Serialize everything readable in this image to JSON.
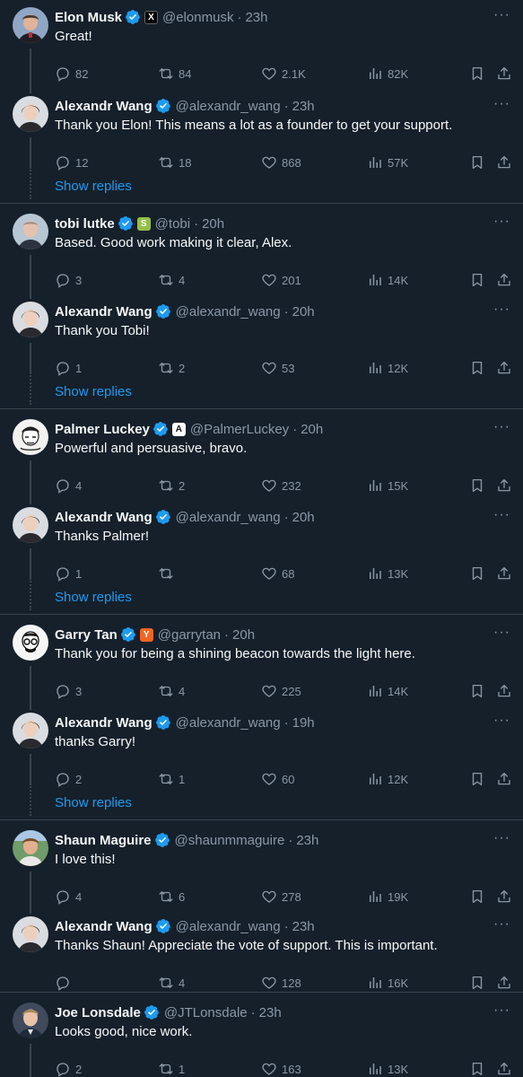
{
  "colors": {
    "background": "#15202b",
    "text": "#f7f9f9",
    "muted": "#8b98a5",
    "accent": "#1d9bf0",
    "divider": "#38444d"
  },
  "show_replies_label": "Show replies",
  "tweets": [
    {
      "name": "Elon Musk",
      "handle": "@elonmusk",
      "time": "23h",
      "affiliation": "X",
      "text": "Great!",
      "replies": "82",
      "retweets": "84",
      "likes": "2.1K",
      "views": "82K"
    },
    {
      "name": "Alexandr Wang",
      "handle": "@alexandr_wang",
      "time": "23h",
      "affiliation": "",
      "text": "Thank you Elon! This means a lot as a founder to get your support.",
      "replies": "12",
      "retweets": "18",
      "likes": "868",
      "views": "57K"
    },
    {
      "name": "tobi lutke",
      "handle": "@tobi",
      "time": "20h",
      "affiliation": "shopify",
      "text": "Based. Good work making it clear, Alex.",
      "replies": "3",
      "retweets": "4",
      "likes": "201",
      "views": "14K"
    },
    {
      "name": "Alexandr Wang",
      "handle": "@alexandr_wang",
      "time": "20h",
      "affiliation": "",
      "text": "Thank you Tobi!",
      "replies": "1",
      "retweets": "2",
      "likes": "53",
      "views": "12K"
    },
    {
      "name": "Palmer Luckey",
      "handle": "@PalmerLuckey",
      "time": "20h",
      "affiliation": "anduril",
      "text": "Powerful and persuasive, bravo.",
      "replies": "4",
      "retweets": "2",
      "likes": "232",
      "views": "15K"
    },
    {
      "name": "Alexandr Wang",
      "handle": "@alexandr_wang",
      "time": "20h",
      "affiliation": "",
      "text": "Thanks Palmer!",
      "replies": "1",
      "retweets": "",
      "likes": "68",
      "views": "13K"
    },
    {
      "name": "Garry Tan",
      "handle": "@garrytan",
      "time": "20h",
      "affiliation": "Y",
      "text": "Thank you for being a shining beacon towards the light here.",
      "replies": "3",
      "retweets": "4",
      "likes": "225",
      "views": "14K"
    },
    {
      "name": "Alexandr Wang",
      "handle": "@alexandr_wang",
      "time": "19h",
      "affiliation": "",
      "text": "thanks Garry!",
      "replies": "2",
      "retweets": "1",
      "likes": "60",
      "views": "12K"
    },
    {
      "name": "Shaun Maguire",
      "handle": "@shaunmmaguire",
      "time": "23h",
      "affiliation": "",
      "text": "I love this!",
      "replies": "4",
      "retweets": "6",
      "likes": "278",
      "views": "19K"
    },
    {
      "name": "Alexandr Wang",
      "handle": "@alexandr_wang",
      "time": "23h",
      "affiliation": "",
      "text": "Thanks Shaun! Appreciate the vote of support. This is important.",
      "replies": "",
      "retweets": "4",
      "likes": "128",
      "views": "16K"
    },
    {
      "name": "Joe Lonsdale",
      "handle": "@JTLonsdale",
      "time": "23h",
      "affiliation": "",
      "text": "Looks good, nice work.",
      "replies": "2",
      "retweets": "1",
      "likes": "163",
      "views": "13K"
    }
  ],
  "icons": [
    "reply-icon",
    "retweet-icon",
    "like-icon",
    "views-icon",
    "bookmark-icon",
    "share-icon",
    "verified-badge-icon",
    "more-icon"
  ]
}
